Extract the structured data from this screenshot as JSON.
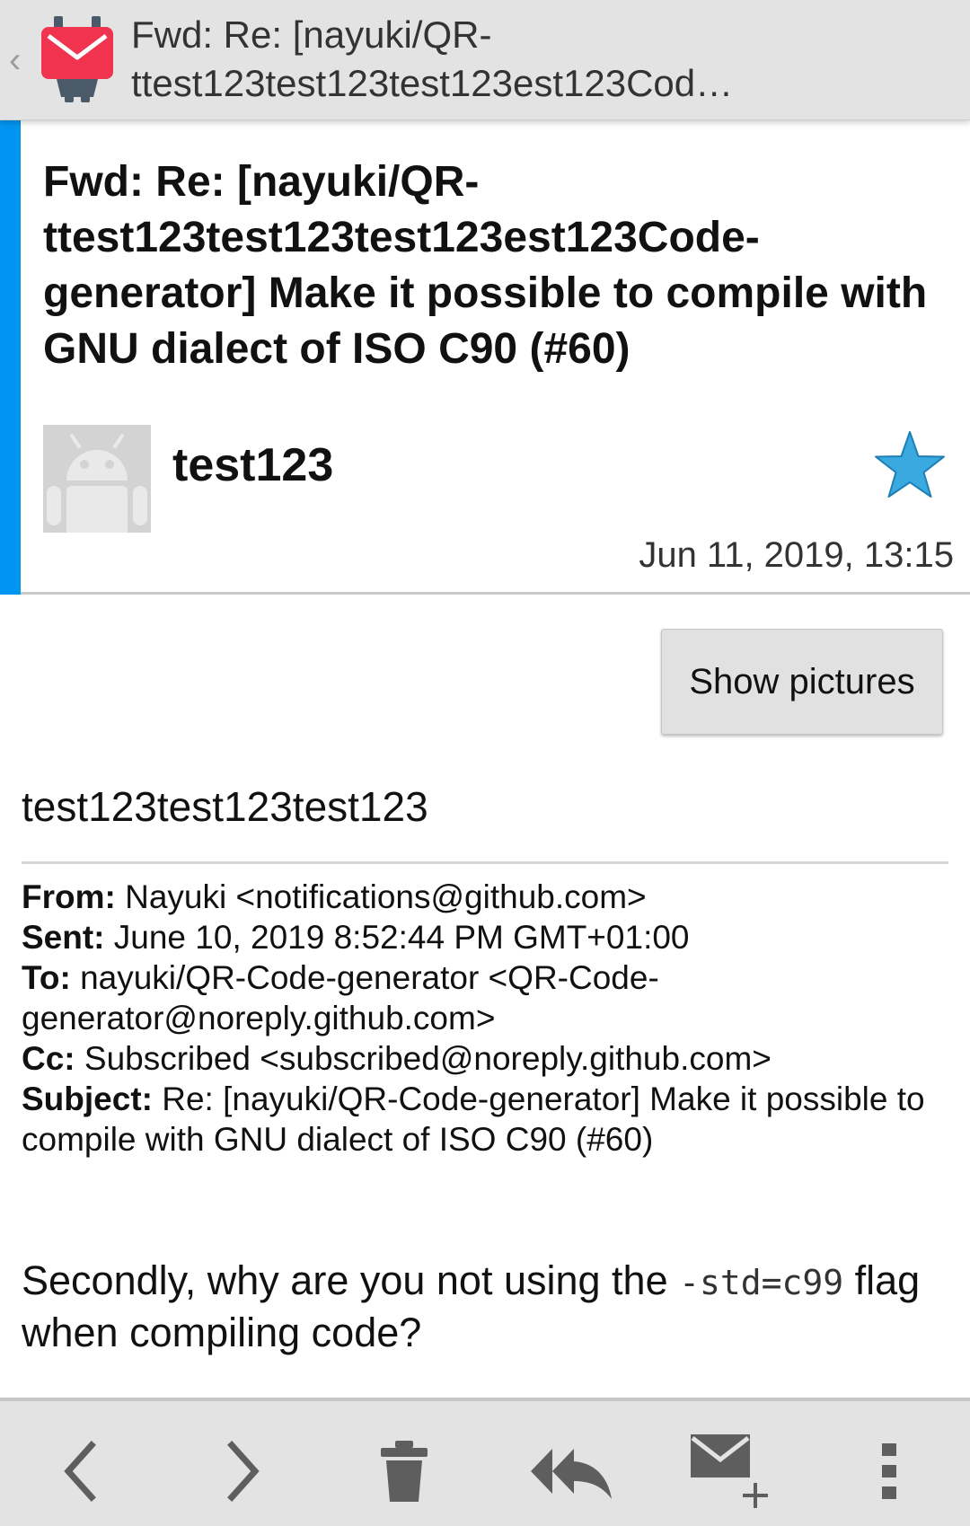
{
  "action_bar": {
    "back_icon": "chevron-left-icon",
    "app_icon": "k9-mail-logo",
    "title_line1": "Fwd: Re: [nayuki/QR-",
    "title_line2": "ttest123test123test123est123Cod…"
  },
  "header": {
    "subject": "Fwd: Re: [nayuki/QR-ttest123test123test123est123Code-generator] Make it possible to compile with GNU dialect of ISO C90 (#60)",
    "sender": "test123",
    "date": "Jun 11, 2019, 13:15",
    "starred": true,
    "accent_color": "#0095f0",
    "star_color": "#39a9e0"
  },
  "body": {
    "show_pictures_label": "Show pictures",
    "intro": "test123test123test123",
    "forward": {
      "from_label": "From:",
      "from_value": "Nayuki <notifications@github.com>",
      "sent_label": "Sent:",
      "sent_value": "June 10, 2019 8:52:44 PM GMT+01:00",
      "to_label": "To:",
      "to_value": "nayuki/QR-Code-generator <QR-Code-generator@noreply.github.com>",
      "cc_label": "Cc:",
      "cc_value": "Subscribed <subscribed@noreply.github.com>",
      "subject_label": "Subject:",
      "subject_value": "Re: [nayuki/QR-Code-generator] Make it possible to compile with GNU dialect of ISO C90 (#60)"
    },
    "message_before": "Secondly, why are you not using the ",
    "message_code": "-std=c99",
    "message_after": " flag when compiling code?"
  },
  "toolbar": {
    "items": [
      "previous-icon",
      "next-icon",
      "delete-icon",
      "reply-all-icon",
      "compose-icon",
      "overflow-menu-icon"
    ]
  }
}
